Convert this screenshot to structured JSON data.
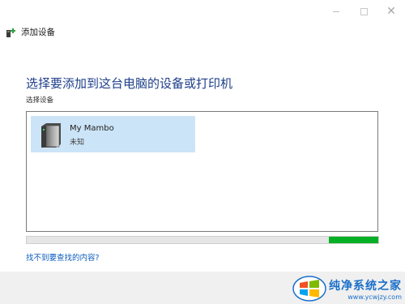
{
  "window": {
    "title": "添加设备",
    "controls": {
      "minimize_icon": "minimize-icon",
      "maximize_icon": "maximize-icon",
      "close_glyph": "✕"
    }
  },
  "main": {
    "heading": "选择要添加到这台电脑的设备或打印机",
    "subheading": "选择设备",
    "devices": [
      {
        "name": "My Mambo",
        "status": "未知",
        "icon": "device-tower-icon",
        "selected": true
      }
    ],
    "search_progress": {
      "start": 0.86,
      "end": 1.0,
      "color": "#06b025"
    },
    "help_link": "找不到要查找的内容?"
  },
  "watermark": {
    "title": "纯净系统之家",
    "url": "www.ycwjzy.com"
  },
  "colors": {
    "heading": "#1e3f8a",
    "selection": "#cce4f7",
    "link": "#0a5bbd",
    "progress": "#06b025"
  }
}
